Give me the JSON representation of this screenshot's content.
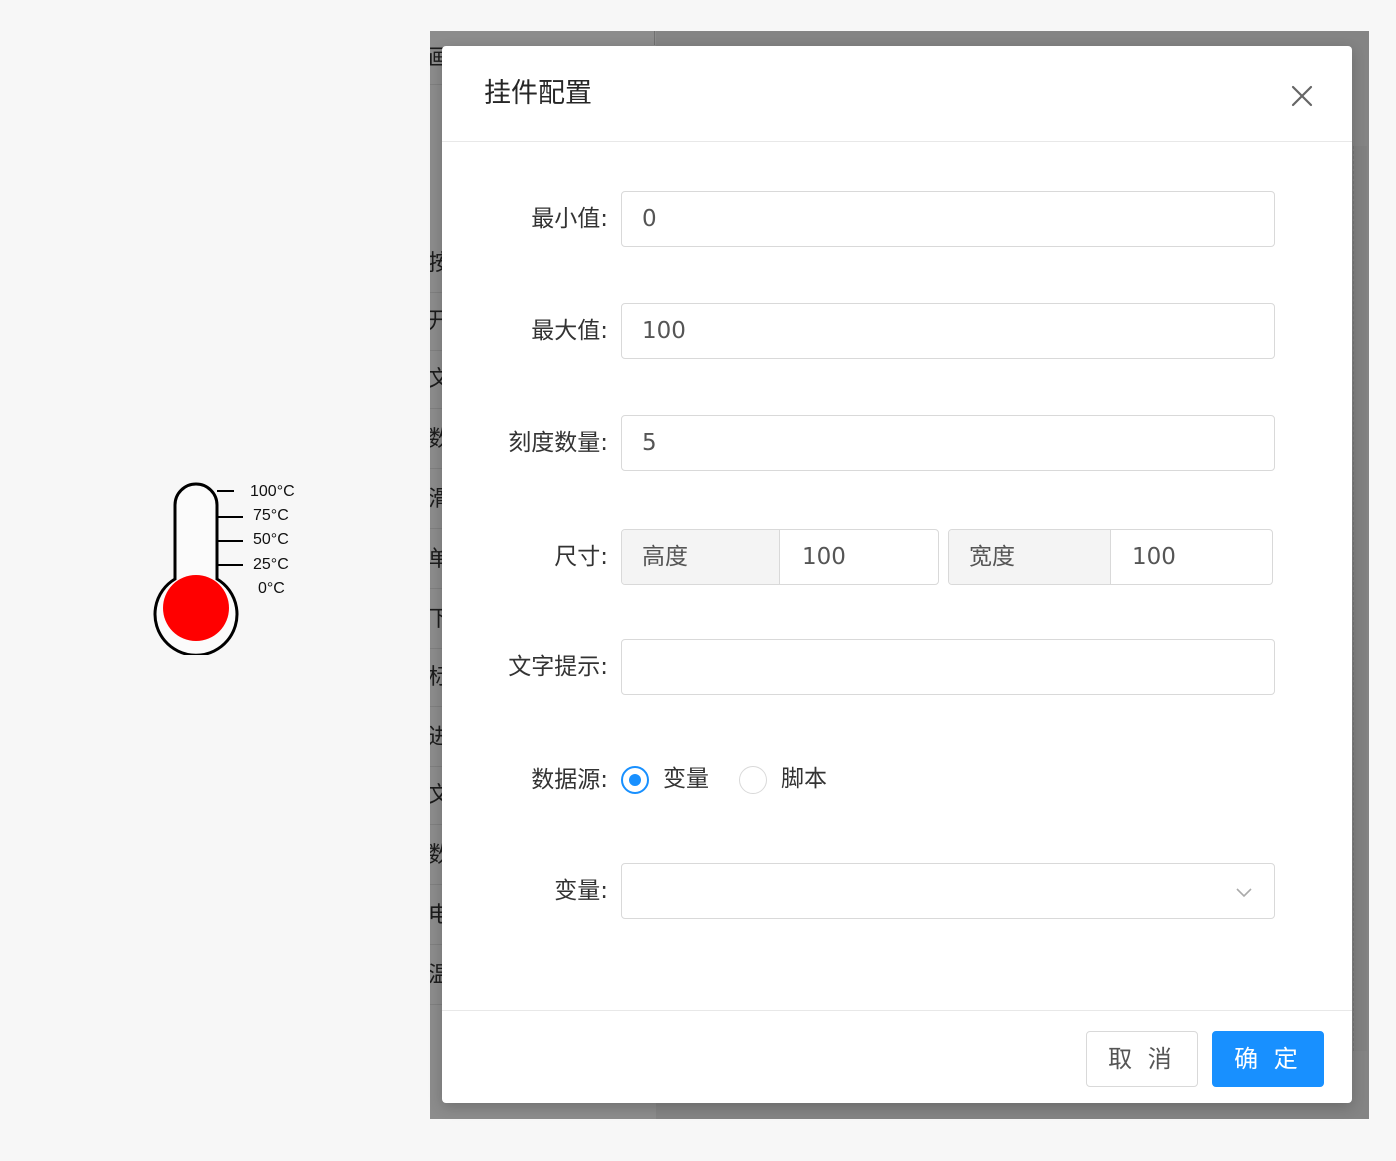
{
  "thermometer": {
    "tick_labels": [
      "100°C",
      "75°C",
      "50°C",
      "25°C",
      "0°C"
    ],
    "bulb_color": "#ff0000"
  },
  "background_list": {
    "header_char": "画",
    "items": [
      "按",
      "开",
      "文",
      "数",
      "滑",
      "单",
      "下",
      "标",
      "进",
      "文",
      "数",
      "电",
      "温"
    ]
  },
  "modal": {
    "title": "挂件配置",
    "close_icon": "close-icon",
    "fields": {
      "min": {
        "label": "最小值:",
        "value": "0"
      },
      "max": {
        "label": "最大值:",
        "value": "100"
      },
      "ticks": {
        "label": "刻度数量:",
        "value": "5"
      },
      "size": {
        "label": "尺寸:",
        "height_addon": "高度",
        "height_value": "100",
        "width_addon": "宽度",
        "width_value": "100"
      },
      "tooltip": {
        "label": "文字提示:",
        "value": ""
      },
      "datasource": {
        "label": "数据源:",
        "options": [
          "变量",
          "脚本"
        ],
        "selected": "变量"
      },
      "variable": {
        "label": "变量:",
        "value": "",
        "arrow_icon": "chevron-down-icon"
      }
    },
    "footer": {
      "cancel": "取 消",
      "ok": "确 定"
    },
    "accent_color": "#1890ff"
  }
}
